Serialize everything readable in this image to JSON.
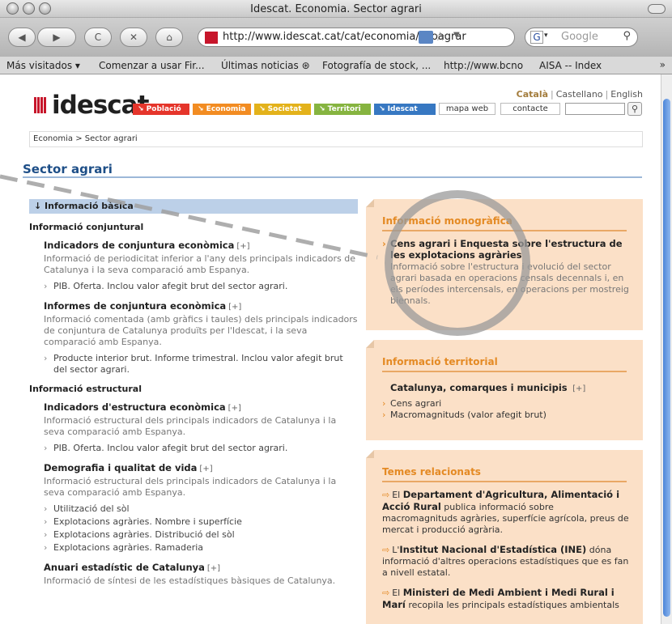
{
  "window": {
    "title": "Idescat. Economia. Sector agrari"
  },
  "toolbar": {
    "back_glyph": "◀",
    "forward_glyph": "▶",
    "reload_glyph": "C",
    "stop_glyph": "✕",
    "home_glyph": "⌂",
    "url": "http://www.idescat.cat/cat/economia/ecoagrar",
    "search_engine_glyph": "G",
    "search_placeholder": "Google"
  },
  "bookmarks": [
    "Más visitados ▾",
    "Comenzar a usar Fir...",
    "Últimas noticias ⊛",
    "Fotografía de stock, ...",
    "http://www.bcno",
    "AISA -- Index"
  ],
  "bookmarks_more": "»",
  "site": {
    "logo_text": "idescat",
    "languages": {
      "active": "Català",
      "sep1": "|",
      "lang2": "Castellano",
      "sep2": "|",
      "lang3": "English"
    },
    "nav_tabs": [
      {
        "label": "↘ Població",
        "color": "#e5352b"
      },
      {
        "label": "↘ Economia",
        "color": "#f28c22"
      },
      {
        "label": "↘ Societat",
        "color": "#e3b21b"
      },
      {
        "label": "↘ Territori",
        "color": "#86b440"
      },
      {
        "label": "↘ Idescat",
        "color": "#3778c2"
      }
    ],
    "nav_links": [
      "mapa web",
      "contacte"
    ],
    "search_value": "",
    "search_glyph": "⚲"
  },
  "breadcrumb": "Economia > Sector agrari",
  "page_title": "Sector agrari",
  "left": {
    "header": "↓ Informació bàsica",
    "sections": [
      {
        "title": "Informació conjuntural",
        "items": [
          {
            "title": "Indicadors de conjuntura econòmica",
            "plus": "[+]",
            "desc": "Informació de periodicitat inferior a l'any dels principals indicadors de Catalunya i la seva comparació amb Espanya.",
            "subs": [
              "PIB. Oferta. Inclou valor afegit brut del sector agrari."
            ]
          },
          {
            "title": "Informes de conjuntura econòmica",
            "plus": "[+]",
            "desc": "Informació comentada (amb gràfics i taules) dels principals indicadors de conjuntura de Catalunya produïts per l'Idescat, i la seva comparació amb Espanya.",
            "subs": [
              "Producte interior brut. Informe trimestral. Inclou valor afegit brut del sector agrari."
            ]
          }
        ]
      },
      {
        "title": "Informació estructural",
        "items": [
          {
            "title": "Indicadors d'estructura econòmica",
            "plus": "[+]",
            "desc": "Informació estructural dels principals indicadors de Catalunya i la seva comparació amb Espanya.",
            "subs": [
              "PIB. Oferta. Inclou valor afegit brut del sector agrari."
            ]
          },
          {
            "title": "Demografia i qualitat de vida",
            "plus": "[+]",
            "desc": "Informació estructural dels principals indicadors de Catalunya i la seva comparació amb Espanya.",
            "subs": [
              "Utilització del sòl",
              "Explotacions agràries. Nombre i superfície",
              "Explotacions agràries. Distribució del sòl",
              "Explotacions agràries. Ramaderia"
            ]
          },
          {
            "title": "Anuari estadístic de Catalunya",
            "plus": "[+]",
            "desc": "Informació de síntesi de les estadístiques bàsiques de Catalunya.",
            "subs": []
          }
        ]
      }
    ]
  },
  "right": {
    "monografica": {
      "title": "Informació monogràfica",
      "item_title": "Cens agrari i Enquesta sobre l'estructura de les explotacions agràries",
      "item_desc": "Informació sobre l'estructura i evolució del sector agrari basada en operacions censals decennals i, en els períodes intercensals, en operacions per mostreig biennals."
    },
    "territorial": {
      "title": "Informació territorial",
      "item_title": "Catalunya, comarques i municipis",
      "plus": "[+]",
      "links": [
        "Cens agrari",
        "Macromagnituds (valor afegit brut)"
      ]
    },
    "temes": {
      "title": "Temes relacionats",
      "arrow": "⇨",
      "items": [
        {
          "pre": "El ",
          "bold": "Departament d'Agricultura, Alimentació i Acció Rural",
          "post": " publica informació sobre macromagnituds agràries, superfície agrícola, preus de mercat i producció agrària."
        },
        {
          "pre": "L'",
          "bold": "Institut Nacional d'Estadística (INE)",
          "post": " dóna informació d'altres operacions estadístiques que es fan a nivell estatal."
        },
        {
          "pre": "El ",
          "bold": "Ministeri de Medi Ambient i Medi Rural i Marí",
          "post": " recopila les principals estadístiques ambientals"
        }
      ]
    }
  },
  "colors": {
    "accent_blue": "#1d4e87",
    "orange": "#e48a24",
    "peach": "#fbe0c7",
    "annotation_gray": "#a0a0a0"
  }
}
